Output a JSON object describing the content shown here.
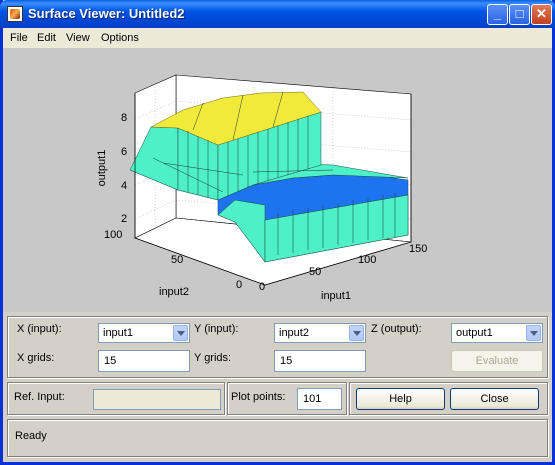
{
  "window": {
    "title": "Surface Viewer: Untitled2"
  },
  "menu": [
    "File",
    "Edit",
    "View",
    "Options"
  ],
  "plot": {
    "zlabel": "output1",
    "ylabel": "input2",
    "xlabel": "input1",
    "z_ticks": [
      "8",
      "6",
      "4",
      "2"
    ],
    "y_ticks": [
      "100",
      "50",
      "0"
    ],
    "x_ticks": [
      "0",
      "50",
      "100",
      "150"
    ],
    "colors": {
      "high": "#f2ea3a",
      "mid": "#4ef0c8",
      "low": "#1e74f0",
      "background": "#c8c8c8"
    }
  },
  "controls": {
    "x_input_label": "X (input):",
    "x_input_value": "input1",
    "y_input_label": "Y (input):",
    "y_input_value": "input2",
    "z_output_label": "Z (output):",
    "z_output_value": "output1",
    "x_grids_label": "X grids:",
    "x_grids_value": "15",
    "y_grids_label": "Y grids:",
    "y_grids_value": "15",
    "evaluate_label": "Evaluate",
    "ref_input_label": "Ref. Input:",
    "ref_input_value": "",
    "plot_points_label": "Plot points:",
    "plot_points_value": "101",
    "help_label": "Help",
    "close_label": "Close"
  },
  "status": {
    "text": "Ready"
  }
}
